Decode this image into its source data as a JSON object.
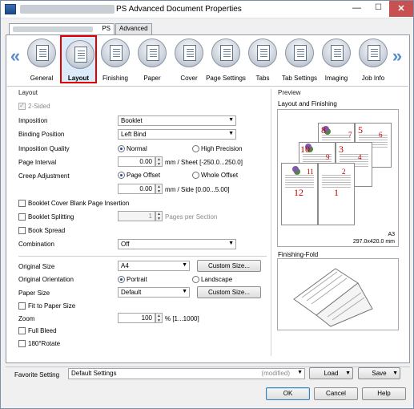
{
  "window": {
    "title": "PS Advanced Document Properties",
    "minimize": "—",
    "maximize": "☐",
    "close": "✕"
  },
  "tabs": [
    {
      "label": "PS"
    },
    {
      "label": "Advanced"
    }
  ],
  "categories": [
    {
      "label": "General"
    },
    {
      "label": "Layout"
    },
    {
      "label": "Finishing"
    },
    {
      "label": "Paper"
    },
    {
      "label": "Cover"
    },
    {
      "label": "Page Settings"
    },
    {
      "label": "Tabs"
    },
    {
      "label": "Tab Settings"
    },
    {
      "label": "Imaging"
    },
    {
      "label": "Job Info"
    }
  ],
  "nav": {
    "left": "«",
    "right": "»"
  },
  "layout": {
    "section_title": "Layout",
    "two_sided": "2-Sided",
    "imposition_label": "Imposition",
    "imposition_value": "Booklet",
    "binding_label": "Binding Position",
    "binding_value": "Left Bind",
    "quality_label": "Imposition Quality",
    "quality_normal": "Normal",
    "quality_high": "High Precision",
    "interval_label": "Page Interval",
    "interval_value": "0.00",
    "interval_unit": "mm / Sheet [-250.0...250.0]",
    "creep_label": "Creep Adjustment",
    "creep_page_offset": "Page Offset",
    "creep_whole_offset": "Whole Offset",
    "creep_value": "0.00",
    "creep_unit": "mm / Side [0.00...5.00]",
    "blank_page": "Booklet Cover Blank Page Insertion",
    "splitting": "Booklet Splitting",
    "splitting_value": "1",
    "splitting_unit": "Pages per Section",
    "book_spread": "Book Spread",
    "combination_label": "Combination",
    "combination_value": "Off",
    "original_size_label": "Original Size",
    "original_size_value": "A4",
    "custom_size_1": "Custom Size...",
    "orientation_label": "Original Orientation",
    "orientation_portrait": "Portrait",
    "orientation_landscape": "Landscape",
    "paper_size_label": "Paper Size",
    "paper_size_value": "Default",
    "custom_size_2": "Custom Size...",
    "fit_to_paper": "Fit to Paper Size",
    "zoom_label": "Zoom",
    "zoom_value": "100",
    "zoom_unit": "% [1...1000]",
    "full_bleed": "Full Bleed",
    "rotate": "180°Rotate"
  },
  "preview": {
    "section_title": "Preview",
    "layout_finishing": "Layout and Finishing",
    "page_numbers": [
      "8",
      "5",
      "6",
      "7",
      "10",
      "3",
      "4",
      "9",
      "12",
      "1",
      "2",
      "11"
    ],
    "paper": "A3",
    "paper_size": "297.0x420.0 mm",
    "finishing_fold": "Finishing-Fold"
  },
  "footer": {
    "favorite_label": "Favorite Setting",
    "favorite_value": "Default Settings",
    "modified": "(modified)",
    "load": "Load",
    "save": "Save",
    "ok": "OK",
    "cancel": "Cancel",
    "help": "Help"
  }
}
